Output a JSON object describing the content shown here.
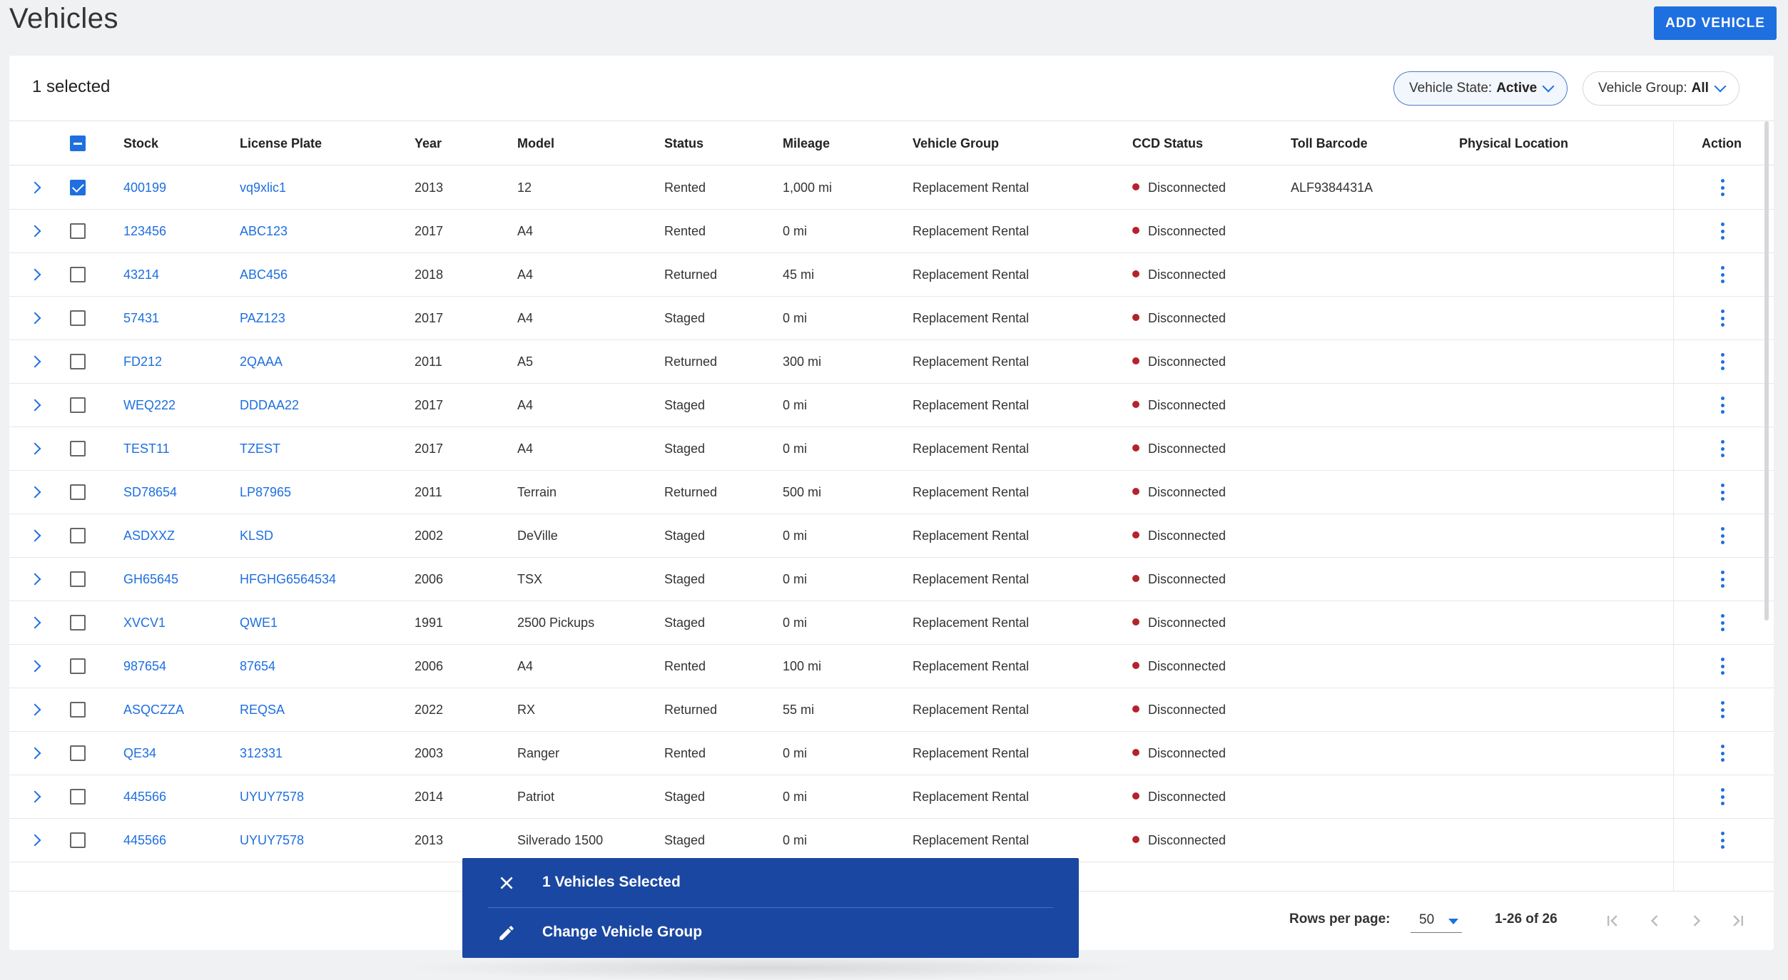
{
  "page": {
    "title": "Vehicles"
  },
  "toolbar": {
    "add_label": "ADD VEHICLE"
  },
  "card": {
    "selected_text": "1 selected",
    "filters": [
      {
        "label": "Vehicle State:",
        "value": "Active",
        "active": true
      },
      {
        "label": "Vehicle Group:",
        "value": "All",
        "active": false
      }
    ]
  },
  "table": {
    "columns": [
      "Stock",
      "License Plate",
      "Year",
      "Model",
      "Status",
      "Mileage",
      "Vehicle Group",
      "CCD Status",
      "Toll Barcode",
      "Physical Location",
      "Action"
    ],
    "rows": [
      {
        "stock": "400199",
        "plate": "vq9xlic1",
        "year": "2013",
        "model": "12",
        "status": "Rented",
        "mileage": "1,000 mi",
        "group": "Replacement Rental",
        "ccd": "Disconnected",
        "toll": "ALF9384431A",
        "location": "",
        "checked": true
      },
      {
        "stock": "123456",
        "plate": "ABC123",
        "year": "2017",
        "model": "A4",
        "status": "Rented",
        "mileage": "0 mi",
        "group": "Replacement Rental",
        "ccd": "Disconnected",
        "toll": "",
        "location": "",
        "checked": false
      },
      {
        "stock": "43214",
        "plate": "ABC456",
        "year": "2018",
        "model": "A4",
        "status": "Returned",
        "mileage": "45 mi",
        "group": "Replacement Rental",
        "ccd": "Disconnected",
        "toll": "",
        "location": "",
        "checked": false
      },
      {
        "stock": "57431",
        "plate": "PAZ123",
        "year": "2017",
        "model": "A4",
        "status": "Staged",
        "mileage": "0 mi",
        "group": "Replacement Rental",
        "ccd": "Disconnected",
        "toll": "",
        "location": "",
        "checked": false
      },
      {
        "stock": "FD212",
        "plate": "2QAAA",
        "year": "2011",
        "model": "A5",
        "status": "Returned",
        "mileage": "300 mi",
        "group": "Replacement Rental",
        "ccd": "Disconnected",
        "toll": "",
        "location": "",
        "checked": false
      },
      {
        "stock": "WEQ222",
        "plate": "DDDAA22",
        "year": "2017",
        "model": "A4",
        "status": "Staged",
        "mileage": "0 mi",
        "group": "Replacement Rental",
        "ccd": "Disconnected",
        "toll": "",
        "location": "",
        "checked": false
      },
      {
        "stock": "TEST11",
        "plate": "TZEST",
        "year": "2017",
        "model": "A4",
        "status": "Staged",
        "mileage": "0 mi",
        "group": "Replacement Rental",
        "ccd": "Disconnected",
        "toll": "",
        "location": "",
        "checked": false
      },
      {
        "stock": "SD78654",
        "plate": "LP87965",
        "year": "2011",
        "model": "Terrain",
        "status": "Returned",
        "mileage": "500 mi",
        "group": "Replacement Rental",
        "ccd": "Disconnected",
        "toll": "",
        "location": "",
        "checked": false
      },
      {
        "stock": "ASDXXZ",
        "plate": "KLSD",
        "year": "2002",
        "model": "DeVille",
        "status": "Staged",
        "mileage": "0 mi",
        "group": "Replacement Rental",
        "ccd": "Disconnected",
        "toll": "",
        "location": "",
        "checked": false
      },
      {
        "stock": "GH65645",
        "plate": "HFGHG6564534",
        "year": "2006",
        "model": "TSX",
        "status": "Staged",
        "mileage": "0 mi",
        "group": "Replacement Rental",
        "ccd": "Disconnected",
        "toll": "",
        "location": "",
        "checked": false
      },
      {
        "stock": "XVCV1",
        "plate": "QWE1",
        "year": "1991",
        "model": "2500 Pickups",
        "status": "Staged",
        "mileage": "0 mi",
        "group": "Replacement Rental",
        "ccd": "Disconnected",
        "toll": "",
        "location": "",
        "checked": false
      },
      {
        "stock": "987654",
        "plate": "87654",
        "year": "2006",
        "model": "A4",
        "status": "Rented",
        "mileage": "100 mi",
        "group": "Replacement Rental",
        "ccd": "Disconnected",
        "toll": "",
        "location": "",
        "checked": false
      },
      {
        "stock": "ASQCZZA",
        "plate": "REQSA",
        "year": "2022",
        "model": "RX",
        "status": "Returned",
        "mileage": "55 mi",
        "group": "Replacement Rental",
        "ccd": "Disconnected",
        "toll": "",
        "location": "",
        "checked": false
      },
      {
        "stock": "QE34",
        "plate": "312331",
        "year": "2003",
        "model": "Ranger",
        "status": "Rented",
        "mileage": "0 mi",
        "group": "Replacement Rental",
        "ccd": "Disconnected",
        "toll": "",
        "location": "",
        "checked": false
      },
      {
        "stock": "445566",
        "plate": "UYUY7578",
        "year": "2014",
        "model": "Patriot",
        "status": "Staged",
        "mileage": "0 mi",
        "group": "Replacement Rental",
        "ccd": "Disconnected",
        "toll": "",
        "location": "",
        "checked": false
      },
      {
        "stock": "445566",
        "plate": "UYUY7578",
        "year": "2013",
        "model": "Silverado 1500",
        "status": "Staged",
        "mileage": "0 mi",
        "group": "Replacement Rental",
        "ccd": "Disconnected",
        "toll": "",
        "location": "",
        "checked": false
      }
    ]
  },
  "pagination": {
    "rows_per_page_label": "Rows per page:",
    "rows_per_page_value": "50",
    "range_text": "1-26 of 26"
  },
  "snackbar": {
    "selected_text": "1 Vehicles Selected",
    "action_text": "Change Vehicle Group"
  },
  "colors": {
    "accent": "#1e6fe0",
    "snackbar": "#1a47a1",
    "status_disconnected": "#b3232a"
  }
}
